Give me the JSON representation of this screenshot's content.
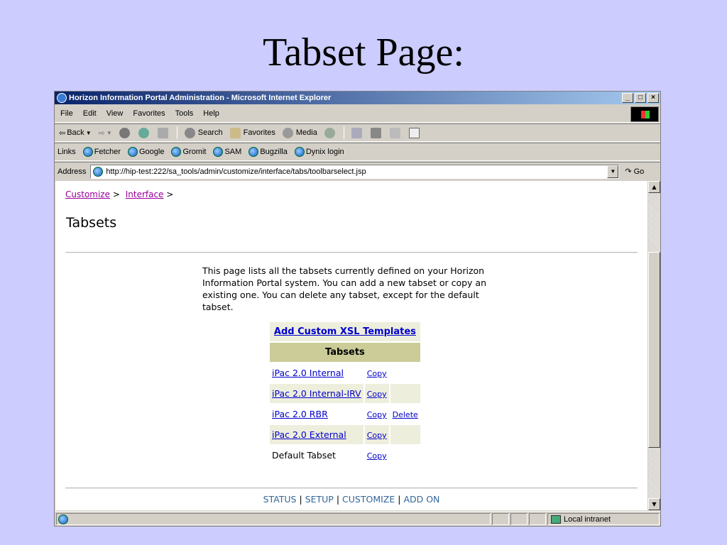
{
  "slide": {
    "title": "Tabset Page:"
  },
  "window": {
    "title": "Horizon Information Portal Administration - Microsoft Internet Explorer",
    "buttons": [
      "_",
      "□",
      "×"
    ]
  },
  "menu": [
    "File",
    "Edit",
    "View",
    "Favorites",
    "Tools",
    "Help"
  ],
  "toolbar": {
    "back": "Back",
    "search": "Search",
    "favorites": "Favorites",
    "media": "Media"
  },
  "links": {
    "label": "Links",
    "items": [
      "Fetcher",
      "Google",
      "Gromit",
      "SAM",
      "Bugzilla",
      "Dynix login"
    ]
  },
  "address": {
    "label": "Address",
    "url": "http://hip-test:222/sa_tools/admin/customize/interface/tabs/toolbarselect.jsp",
    "go": "Go"
  },
  "page": {
    "breadcrumb": [
      "Customize",
      "Interface"
    ],
    "breadcrumb_sep": ">",
    "heading": "Tabsets",
    "description": "This page lists all the tabsets currently defined on your Horizon Information Portal system. You can add a new tabset or copy an existing one. You can delete any tabset, except for the default tabset.",
    "add_templates": "Add Custom XSL Templates",
    "table_header": "Tabsets",
    "rows": [
      {
        "name": "iPac 2.0 Internal",
        "copy": "Copy",
        "delete": ""
      },
      {
        "name": "iPac 2.0 Internal-IRV",
        "copy": "Copy",
        "delete": ""
      },
      {
        "name": "iPac 2.0 RBR",
        "copy": "Copy",
        "delete": "Delete"
      },
      {
        "name": "iPac 2.0 External",
        "copy": "Copy",
        "delete": ""
      },
      {
        "name": "Default Tabset",
        "copy": "Copy",
        "delete": ""
      }
    ],
    "footer": [
      "STATUS",
      "SETUP",
      "CUSTOMIZE",
      "ADD ON"
    ],
    "footer_sep": "|"
  },
  "status": {
    "zone": "Local intranet"
  },
  "colors": {
    "background": "#ccccff",
    "link": "#0000cc",
    "visited": "#990099",
    "header": "#cccc99",
    "shade": "#eeeedd",
    "footer": "#336699"
  }
}
